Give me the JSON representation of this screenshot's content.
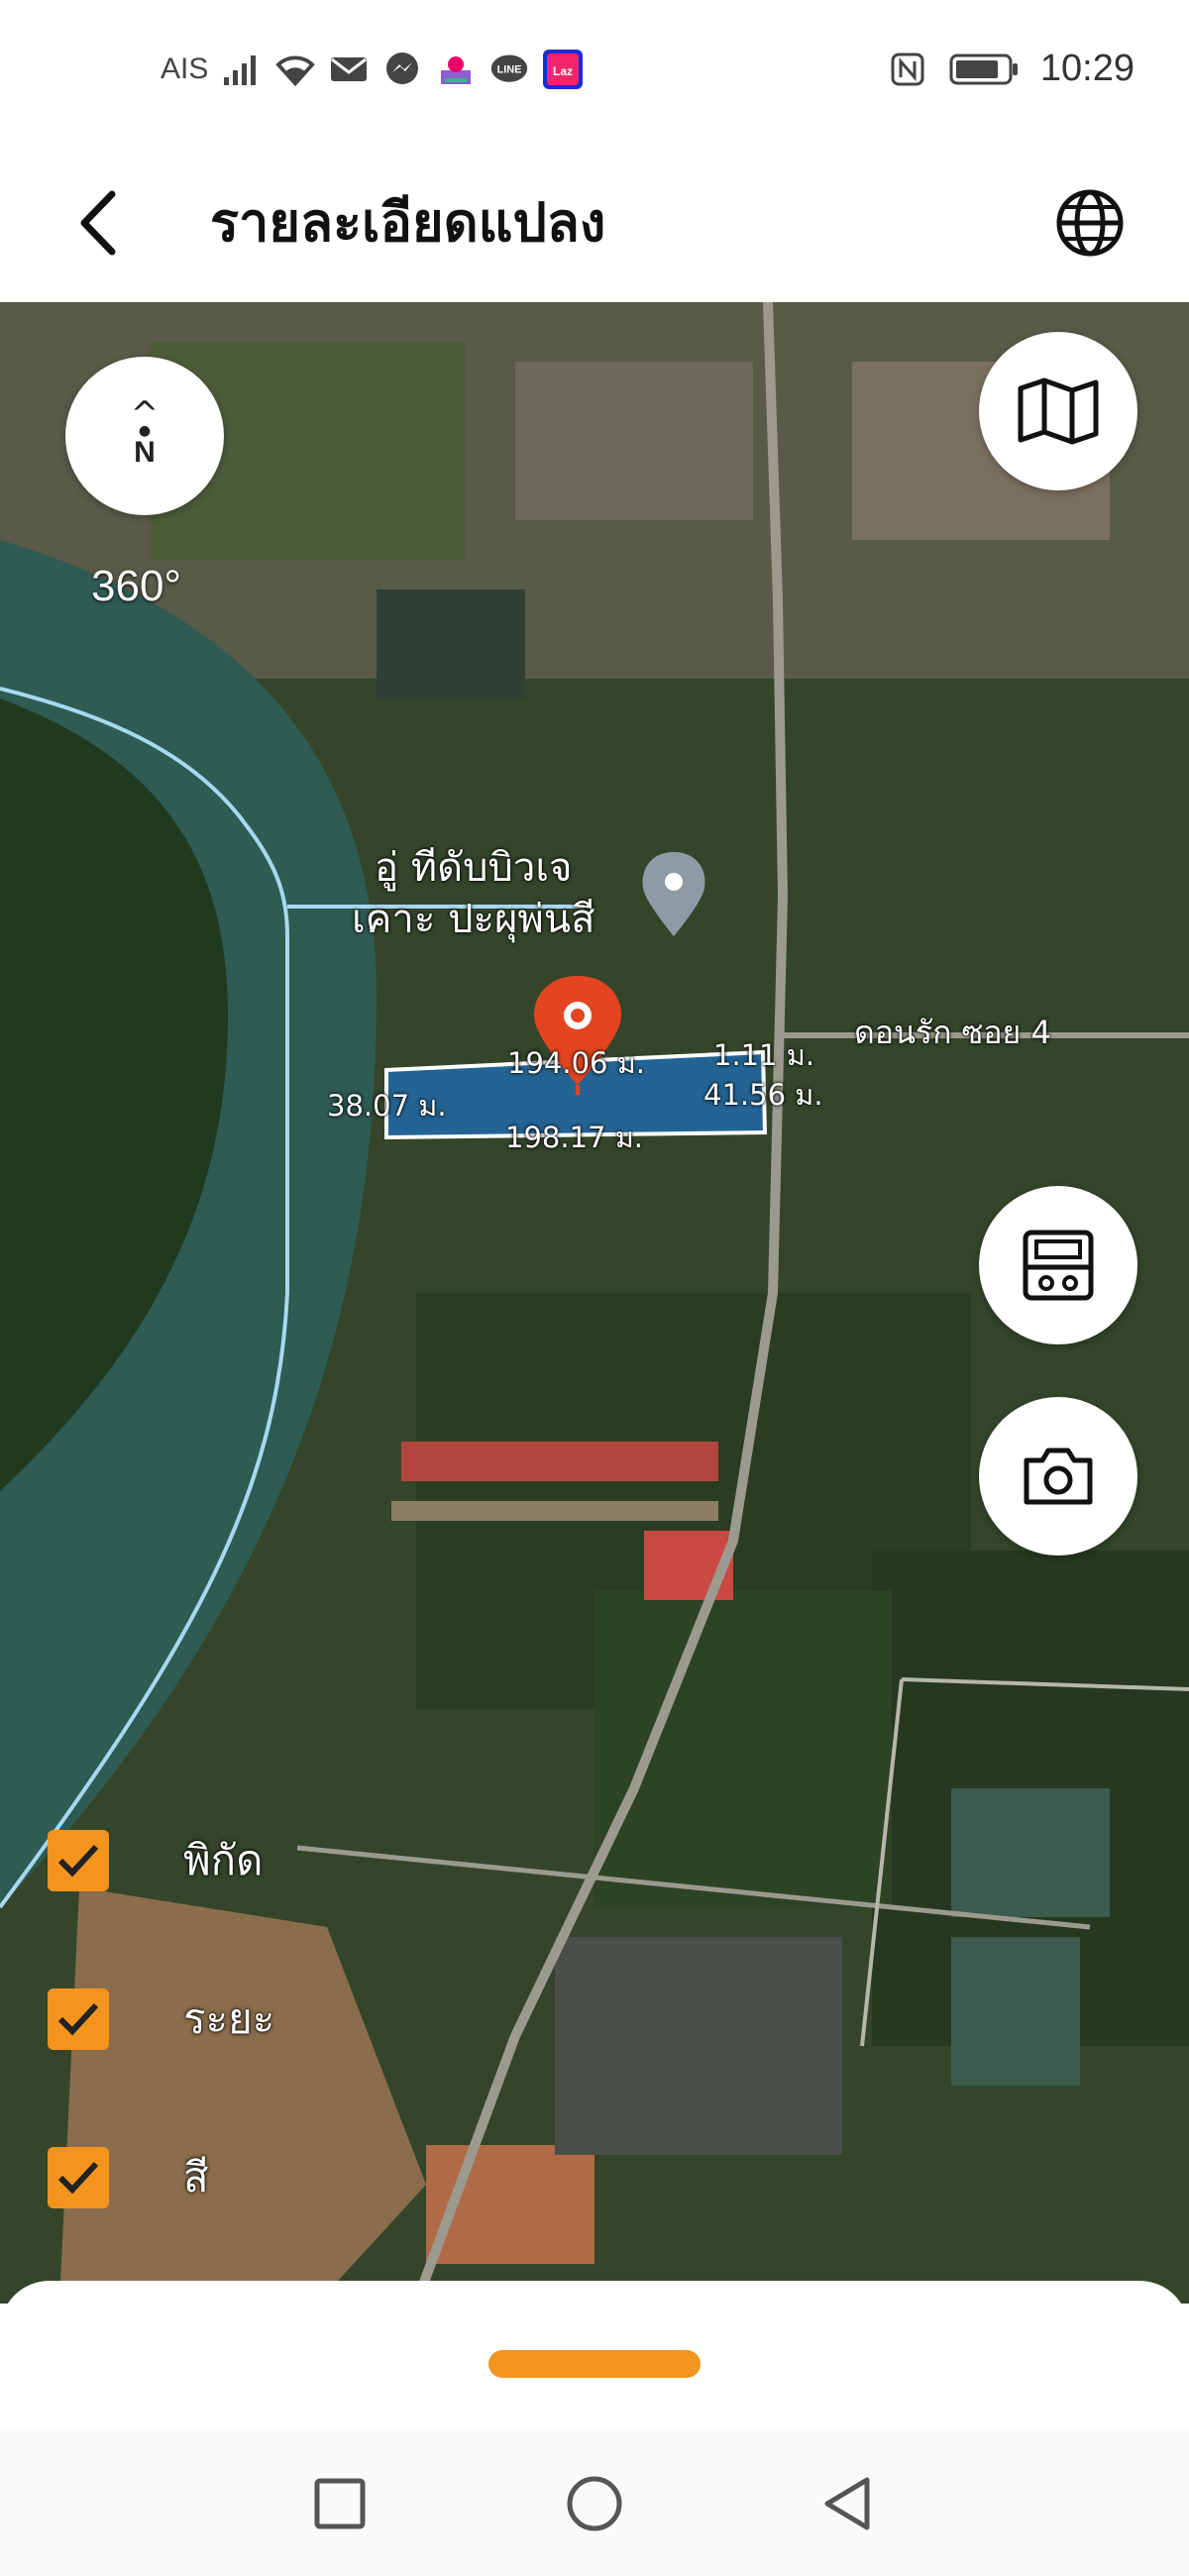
{
  "status_bar": {
    "carrier": "AIS",
    "time": "10:29",
    "icons": [
      "signal-icon",
      "wifi-icon",
      "mail-icon",
      "messenger-icon",
      "app-icon",
      "line-icon",
      "lazada-icon",
      "nfc-icon",
      "battery-icon"
    ]
  },
  "header": {
    "title": "รายละเอียดแปลง",
    "back_icon": "chevron-left-icon",
    "globe_icon": "globe-icon"
  },
  "map": {
    "compass_symbol": "^",
    "compass_label": "N",
    "rotation": "360°",
    "place_name_line1": "อู่ ทีดับบิวเจ",
    "place_name_line2": "เคาะ ปะผุพ่นสี",
    "road_name": "ดอนรัก ซอย 4",
    "dimensions": {
      "top": "194.06 ม.",
      "left": "38.07 ม.",
      "right_top": "1.11 ม.",
      "right": "41.56 ม.",
      "bottom": "198.17 ม."
    },
    "accent_color": "#f3941e",
    "pin_color": "#e2451f",
    "parcel_fill": "#1f6fb8"
  },
  "toggles": [
    {
      "label": "พิกัด",
      "checked": true
    },
    {
      "label": "ระยะ",
      "checked": true
    },
    {
      "label": "สี",
      "checked": true
    }
  ],
  "nav_bar": {
    "recent_icon": "square-icon",
    "home_icon": "circle-icon",
    "back_icon": "triangle-back-icon"
  }
}
